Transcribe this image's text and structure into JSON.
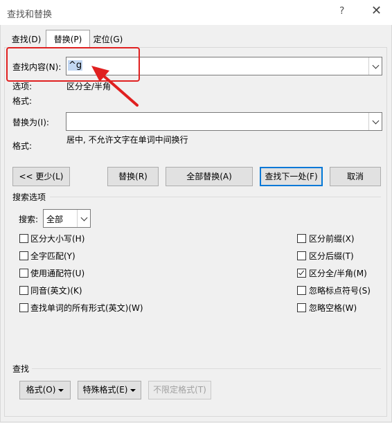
{
  "window": {
    "title": "查找和替换",
    "help_label": "?",
    "close_label": "✕"
  },
  "tabs": [
    {
      "label": "查找(D)",
      "active": false
    },
    {
      "label": "替换(P)",
      "active": true
    },
    {
      "label": "定位(G)",
      "active": false
    }
  ],
  "find": {
    "label": "查找内容(N):",
    "value": "^g",
    "options_label": "选项:",
    "options_value": "区分全/半角",
    "format_label": "格式:"
  },
  "replace": {
    "label": "替换为(I):",
    "value": "",
    "format_label": "格式:",
    "format_value": "居中, 不允许文字在单词中间换行"
  },
  "buttons": {
    "less": "<< 更少(L)",
    "replace": "替换(R)",
    "replace_all": "全部替换(A)",
    "find_next": "查找下一处(F)",
    "cancel": "取消"
  },
  "search_options": {
    "title": "搜索选项",
    "search_label": "搜索:",
    "search_value": "全部",
    "left": [
      {
        "label": "区分大小写(H)",
        "checked": false
      },
      {
        "label": "全字匹配(Y)",
        "checked": false
      },
      {
        "label": "使用通配符(U)",
        "checked": false
      },
      {
        "label": "同音(英文)(K)",
        "checked": false
      },
      {
        "label": "查找单词的所有形式(英文)(W)",
        "checked": false
      }
    ],
    "right": [
      {
        "label": "区分前缀(X)",
        "checked": false
      },
      {
        "label": "区分后缀(T)",
        "checked": false
      },
      {
        "label": "区分全/半角(M)",
        "checked": true
      },
      {
        "label": "忽略标点符号(S)",
        "checked": false
      },
      {
        "label": "忽略空格(W)",
        "checked": false
      }
    ]
  },
  "bottom": {
    "title": "查找",
    "format_btn": "格式(O)",
    "special_btn": "特殊格式(E)",
    "no_format_btn": "不限定格式(T)"
  },
  "colors": {
    "highlight": "#c2d7f2",
    "annotation_red": "#e02020",
    "default_button_border": "#0078d7"
  }
}
